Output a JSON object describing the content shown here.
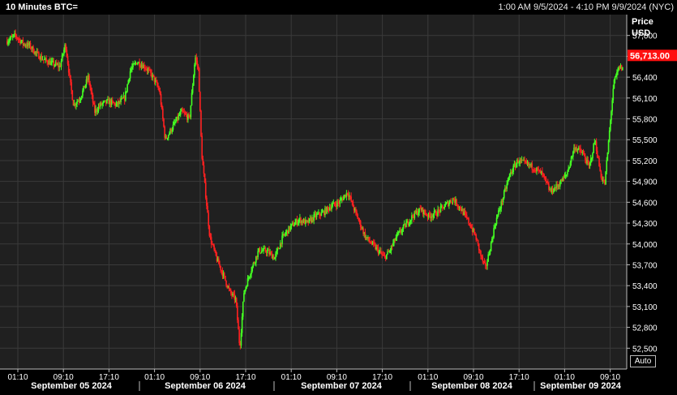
{
  "header": {
    "title": "10 Minutes BTC=",
    "range": "1:00 AM 9/5/2024 - 4:10 PM 9/9/2024 (NYC)"
  },
  "axis_label": {
    "line1": "Price",
    "line2": "USD"
  },
  "current_price_label": "56,713.00",
  "auto_button": "Auto",
  "colors": {
    "background": "#000000",
    "plot_bg": "#202020",
    "grid": "#3a3a3a",
    "up": "#44ff22",
    "down": "#ff2020",
    "price_tag": "#ff1010"
  },
  "chart_data": {
    "type": "candlestick",
    "title": "10 Minutes BTC=",
    "ylabel": "Price USD",
    "ylim": [
      52200,
      57300
    ],
    "y_ticks": [
      57000,
      56700,
      56400,
      56100,
      55800,
      55500,
      55200,
      54900,
      54600,
      54300,
      54000,
      53700,
      53400,
      53100,
      52800,
      52500
    ],
    "y_tick_labels": [
      "57,000",
      "56,700",
      "56,400",
      "56,100",
      "55,800",
      "55,500",
      "55,200",
      "54,900",
      "54,600",
      "54,300",
      "54,000",
      "53,700",
      "53,400",
      "53,100",
      "52,800",
      "52,500"
    ],
    "x_ticks": [
      "01:10",
      "09:10",
      "17:10",
      "01:10",
      "09:10",
      "17:10",
      "01:10",
      "09:10",
      "17:10",
      "01:10",
      "09:10",
      "17:10",
      "01:10",
      "09:10"
    ],
    "dates": [
      "September 05 2024",
      "September 06 2024",
      "September 07 2024",
      "September 08 2024",
      "September 09 2024"
    ],
    "last_price": 56713.0,
    "grid": true,
    "series": [
      {
        "name": "BTC=",
        "path": [
          [
            0,
            56920
          ],
          [
            10,
            57000
          ],
          [
            20,
            56880
          ],
          [
            28,
            56850
          ],
          [
            35,
            56750
          ],
          [
            45,
            56650
          ],
          [
            55,
            56600
          ],
          [
            65,
            56550
          ],
          [
            72,
            56880
          ],
          [
            78,
            56300
          ],
          [
            82,
            56000
          ],
          [
            90,
            56100
          ],
          [
            100,
            56400
          ],
          [
            108,
            55900
          ],
          [
            115,
            56000
          ],
          [
            125,
            56050
          ],
          [
            135,
            56000
          ],
          [
            145,
            56100
          ],
          [
            152,
            56500
          ],
          [
            160,
            56620
          ],
          [
            170,
            56550
          ],
          [
            180,
            56400
          ],
          [
            188,
            56200
          ],
          [
            195,
            55500
          ],
          [
            205,
            55700
          ],
          [
            215,
            55900
          ],
          [
            225,
            55800
          ],
          [
            232,
            56700
          ],
          [
            236,
            56500
          ],
          [
            240,
            55300
          ],
          [
            245,
            54700
          ],
          [
            250,
            54100
          ],
          [
            258,
            53800
          ],
          [
            265,
            53600
          ],
          [
            275,
            53300
          ],
          [
            282,
            53200
          ],
          [
            287,
            52500
          ],
          [
            292,
            53300
          ],
          [
            300,
            53600
          ],
          [
            310,
            53900
          ],
          [
            320,
            53900
          ],
          [
            330,
            53800
          ],
          [
            340,
            54100
          ],
          [
            350,
            54250
          ],
          [
            360,
            54350
          ],
          [
            370,
            54300
          ],
          [
            380,
            54400
          ],
          [
            390,
            54450
          ],
          [
            400,
            54550
          ],
          [
            410,
            54600
          ],
          [
            420,
            54750
          ],
          [
            428,
            54500
          ],
          [
            435,
            54300
          ],
          [
            442,
            54100
          ],
          [
            450,
            54000
          ],
          [
            458,
            53900
          ],
          [
            465,
            53800
          ],
          [
            472,
            53900
          ],
          [
            480,
            54100
          ],
          [
            490,
            54250
          ],
          [
            500,
            54400
          ],
          [
            510,
            54500
          ],
          [
            520,
            54400
          ],
          [
            530,
            54450
          ],
          [
            540,
            54550
          ],
          [
            550,
            54650
          ],
          [
            560,
            54500
          ],
          [
            570,
            54300
          ],
          [
            578,
            54100
          ],
          [
            585,
            53800
          ],
          [
            590,
            53650
          ],
          [
            595,
            53900
          ],
          [
            602,
            54300
          ],
          [
            610,
            54600
          ],
          [
            620,
            55000
          ],
          [
            630,
            55200
          ],
          [
            640,
            55150
          ],
          [
            650,
            55100
          ],
          [
            660,
            55000
          ],
          [
            670,
            54750
          ],
          [
            680,
            54850
          ],
          [
            690,
            55000
          ],
          [
            700,
            55400
          ],
          [
            710,
            55300
          ],
          [
            718,
            55100
          ],
          [
            725,
            55500
          ],
          [
            732,
            55000
          ],
          [
            737,
            54850
          ],
          [
            742,
            55500
          ],
          [
            748,
            56300
          ],
          [
            755,
            56550
          ],
          [
            762,
            56500
          ],
          [
            768,
            56713
          ]
        ]
      }
    ]
  }
}
